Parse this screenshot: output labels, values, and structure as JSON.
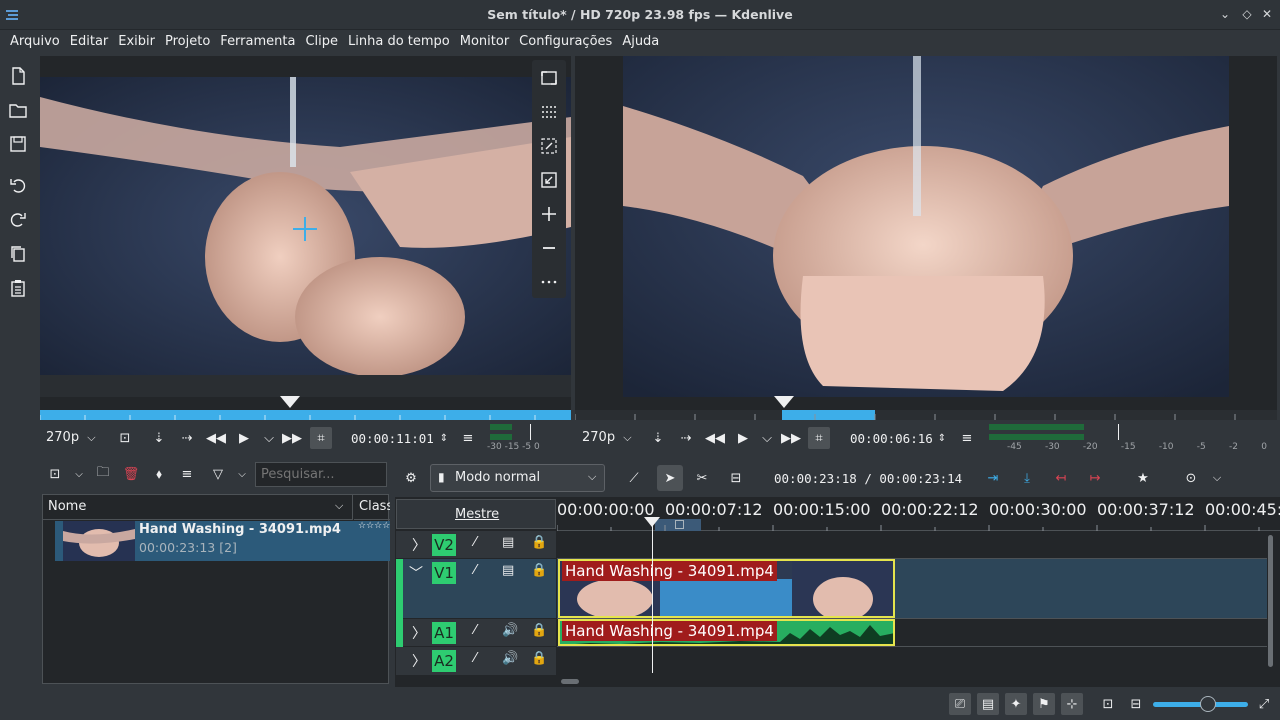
{
  "window": {
    "title": "Sem título* / HD 720p 23.98 fps — Kdenlive"
  },
  "menu": [
    "Arquivo",
    "Editar",
    "Exibir",
    "Projeto",
    "Ferramenta",
    "Clipe",
    "Linha do tempo",
    "Monitor",
    "Configurações",
    "Ajuda"
  ],
  "clip_monitor": {
    "resolution": "270p",
    "timecode": "00:00:11:01",
    "audio_scale": [
      "-30",
      "-15",
      "-5",
      "0"
    ]
  },
  "project_monitor": {
    "resolution": "270p",
    "timecode": "00:00:06:16",
    "audio_scale": [
      "-45",
      "-30",
      "-20",
      "-15",
      "-10",
      "-5",
      "-2",
      "0"
    ]
  },
  "bin": {
    "search_placeholder": "Pesquisar...",
    "col_name": "Nome",
    "col_class": "Class",
    "item": {
      "name": "Hand Washing - 34091.mp4",
      "duration": "00:00:23:13 [2]",
      "stars": "☆☆☆☆"
    }
  },
  "timeline": {
    "mode": "Modo normal",
    "position": "00:00:23:18",
    "duration": "00:00:23:14",
    "separator": "/",
    "master_label": "Mestre",
    "ruler": [
      "00:00:00:00",
      "00:00:07:12",
      "00:00:15:00",
      "00:00:22:12",
      "00:00:30:00",
      "00:00:37:12",
      "00:00:45:"
    ],
    "tracks": [
      {
        "name": "V2",
        "type": "video"
      },
      {
        "name": "V1",
        "type": "video"
      },
      {
        "name": "A1",
        "type": "audio"
      },
      {
        "name": "A2",
        "type": "audio"
      }
    ],
    "video_clip": "Hand Washing - 34091.mp4",
    "audio_clip": "Hand Washing - 34091.mp4"
  },
  "colors": {
    "window_bg": "#31363b",
    "accent": "#3daee9",
    "track_label": "#2ecc71",
    "clip_name_bg": "#a01c1c",
    "audio_wave": "#27ae60",
    "clip_border": "#e5e44d"
  }
}
